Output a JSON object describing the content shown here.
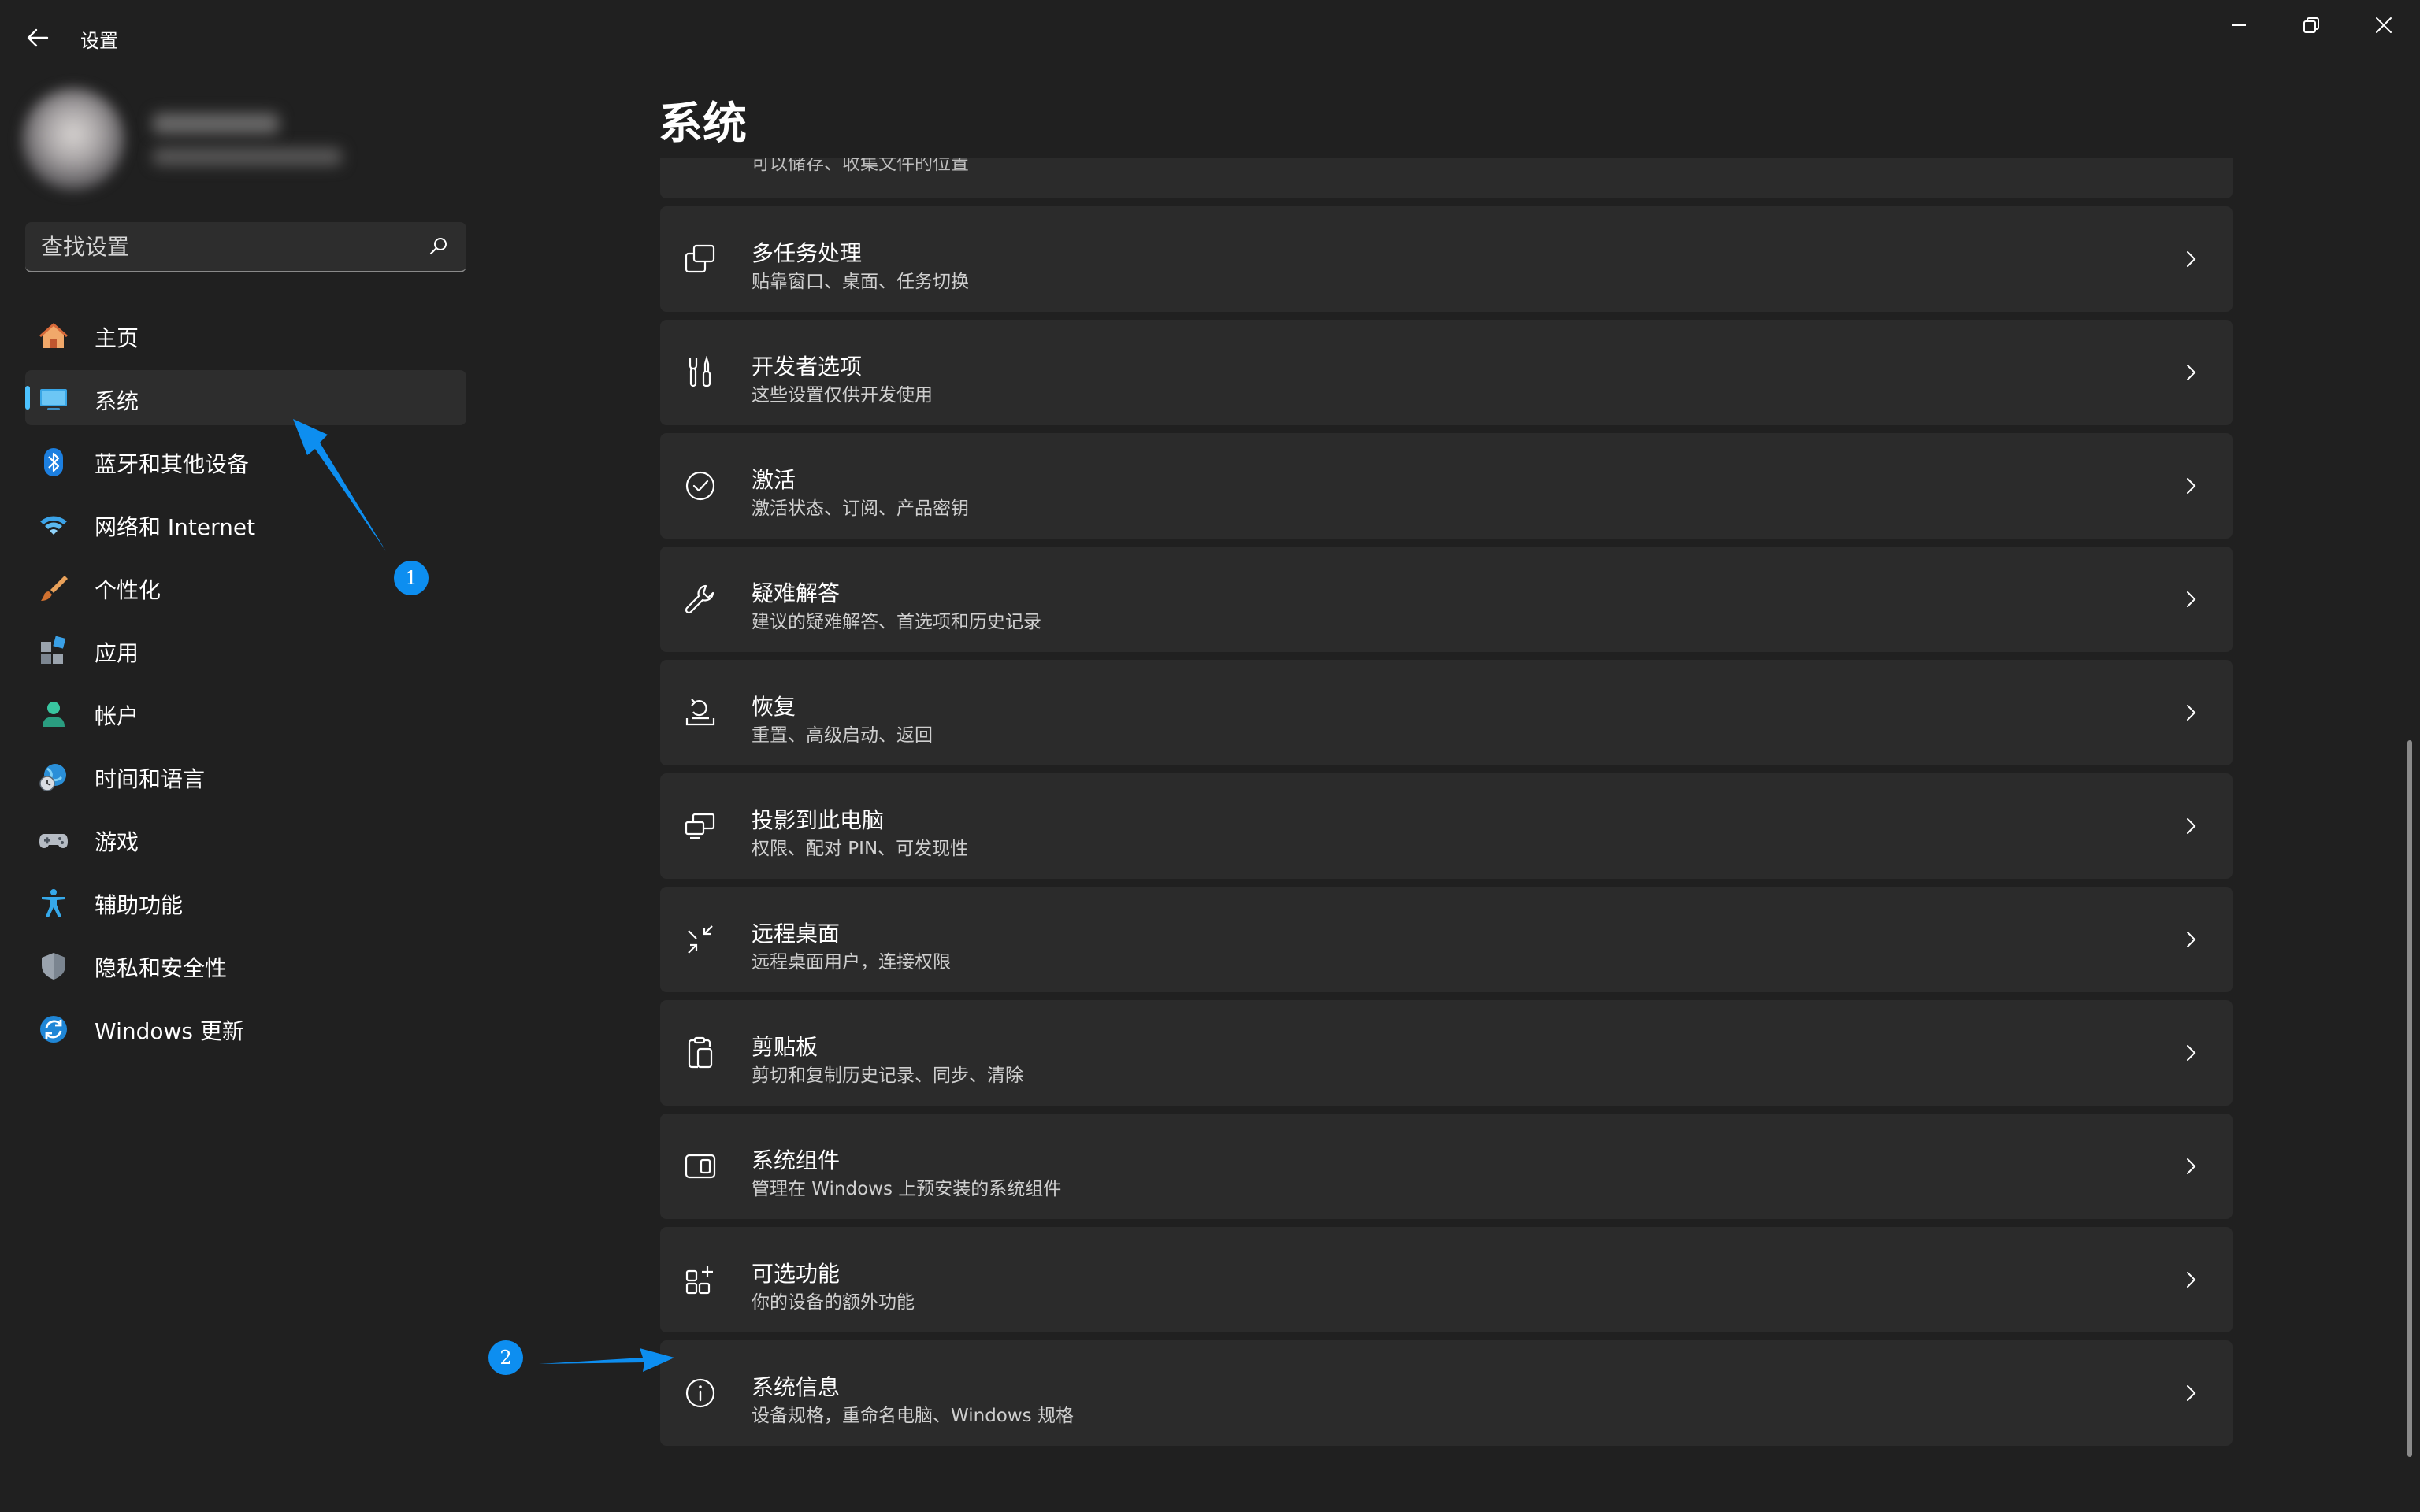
{
  "window": {
    "app_title": "设置"
  },
  "search": {
    "placeholder": "查找设置"
  },
  "sidebar": {
    "items": [
      {
        "label": "主页",
        "icon": "home-icon"
      },
      {
        "label": "系统",
        "icon": "system-monitor-icon",
        "active": true
      },
      {
        "label": "蓝牙和其他设备",
        "icon": "bluetooth-icon"
      },
      {
        "label": "网络和 Internet",
        "icon": "wifi-icon"
      },
      {
        "label": "个性化",
        "icon": "brush-icon"
      },
      {
        "label": "应用",
        "icon": "apps-icon"
      },
      {
        "label": "帐户",
        "icon": "account-icon"
      },
      {
        "label": "时间和语言",
        "icon": "globe-clock-icon"
      },
      {
        "label": "游戏",
        "icon": "gamepad-icon"
      },
      {
        "label": "辅助功能",
        "icon": "accessibility-icon"
      },
      {
        "label": "隐私和安全性",
        "icon": "shield-icon"
      },
      {
        "label": "Windows 更新",
        "icon": "update-icon"
      }
    ]
  },
  "main": {
    "title": "系统",
    "partial_top_text": "可以储存、收集文件的位置",
    "rows": [
      {
        "title": "多任务处理",
        "sub": "贴靠窗口、桌面、任务切换",
        "icon": "multitask-icon"
      },
      {
        "title": "开发者选项",
        "sub": "这些设置仅供开发使用",
        "icon": "developer-tools-icon"
      },
      {
        "title": "激活",
        "sub": "激活状态、订阅、产品密钥",
        "icon": "check-circle-icon"
      },
      {
        "title": "疑难解答",
        "sub": "建议的疑难解答、首选项和历史记录",
        "icon": "wrench-icon"
      },
      {
        "title": "恢复",
        "sub": "重置、高级启动、返回",
        "icon": "recovery-icon"
      },
      {
        "title": "投影到此电脑",
        "sub": "权限、配对 PIN、可发现性",
        "icon": "project-icon"
      },
      {
        "title": "远程桌面",
        "sub": "远程桌面用户，连接权限",
        "icon": "remote-desktop-icon"
      },
      {
        "title": "剪贴板",
        "sub": "剪切和复制历史记录、同步、清除",
        "icon": "clipboard-icon"
      },
      {
        "title": "系统组件",
        "sub": "管理在 Windows 上预安装的系统组件",
        "icon": "components-icon"
      },
      {
        "title": "可选功能",
        "sub": "你的设备的额外功能",
        "icon": "optional-features-icon"
      },
      {
        "title": "系统信息",
        "sub": "设备规格，重命名电脑、Windows 规格",
        "icon": "info-icon"
      }
    ]
  },
  "annotations": {
    "badge1": "1",
    "badge2": "2",
    "color": "#0d8ef0"
  },
  "colors": {
    "background": "#202020",
    "card": "#2b2b2b",
    "accent": "#4cc2ff"
  }
}
